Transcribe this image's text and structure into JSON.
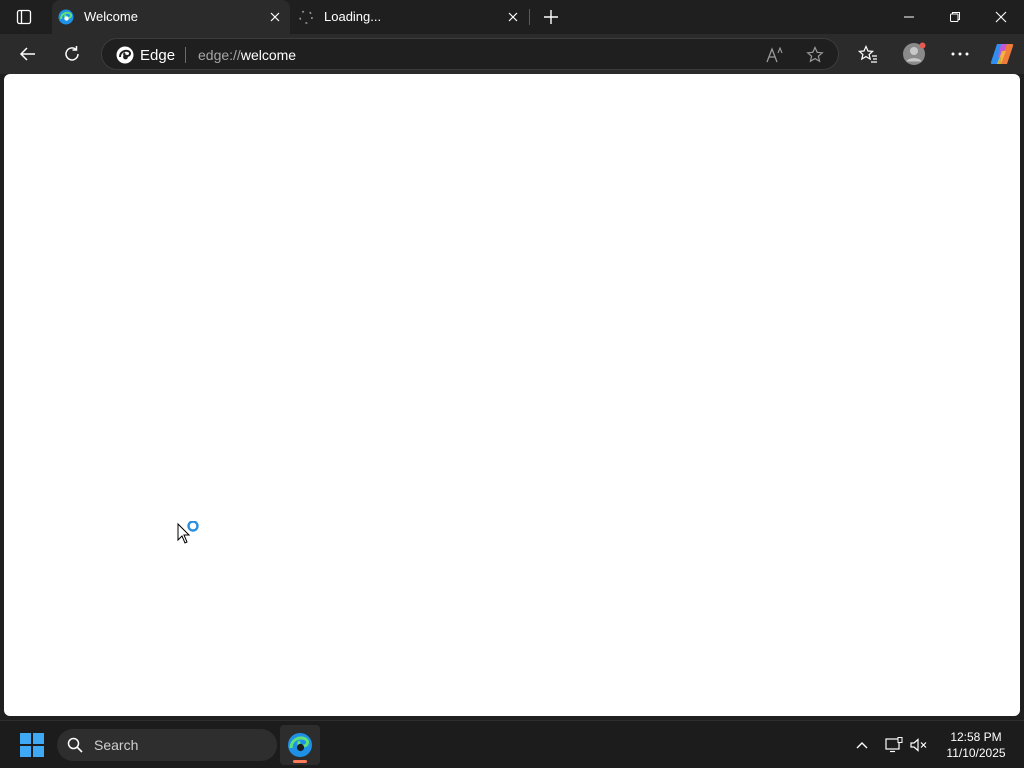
{
  "browser": {
    "tabs": [
      {
        "title": "Welcome",
        "state": "active"
      },
      {
        "title": "Loading...",
        "state": "loading"
      }
    ],
    "address": {
      "badge": "Edge",
      "url_scheme": "edge://",
      "url_path": "welcome"
    },
    "read_aloud_label": "Aᴬ"
  },
  "taskbar": {
    "search_label": "Search",
    "time": "12:58 PM",
    "date": "11/10/2025"
  },
  "colors": {
    "edge_blue": "#1e90e6",
    "edge_green": "#34c759",
    "accent_indicator": "#ff7a59",
    "cursor_busy": "#2b8fe0"
  }
}
